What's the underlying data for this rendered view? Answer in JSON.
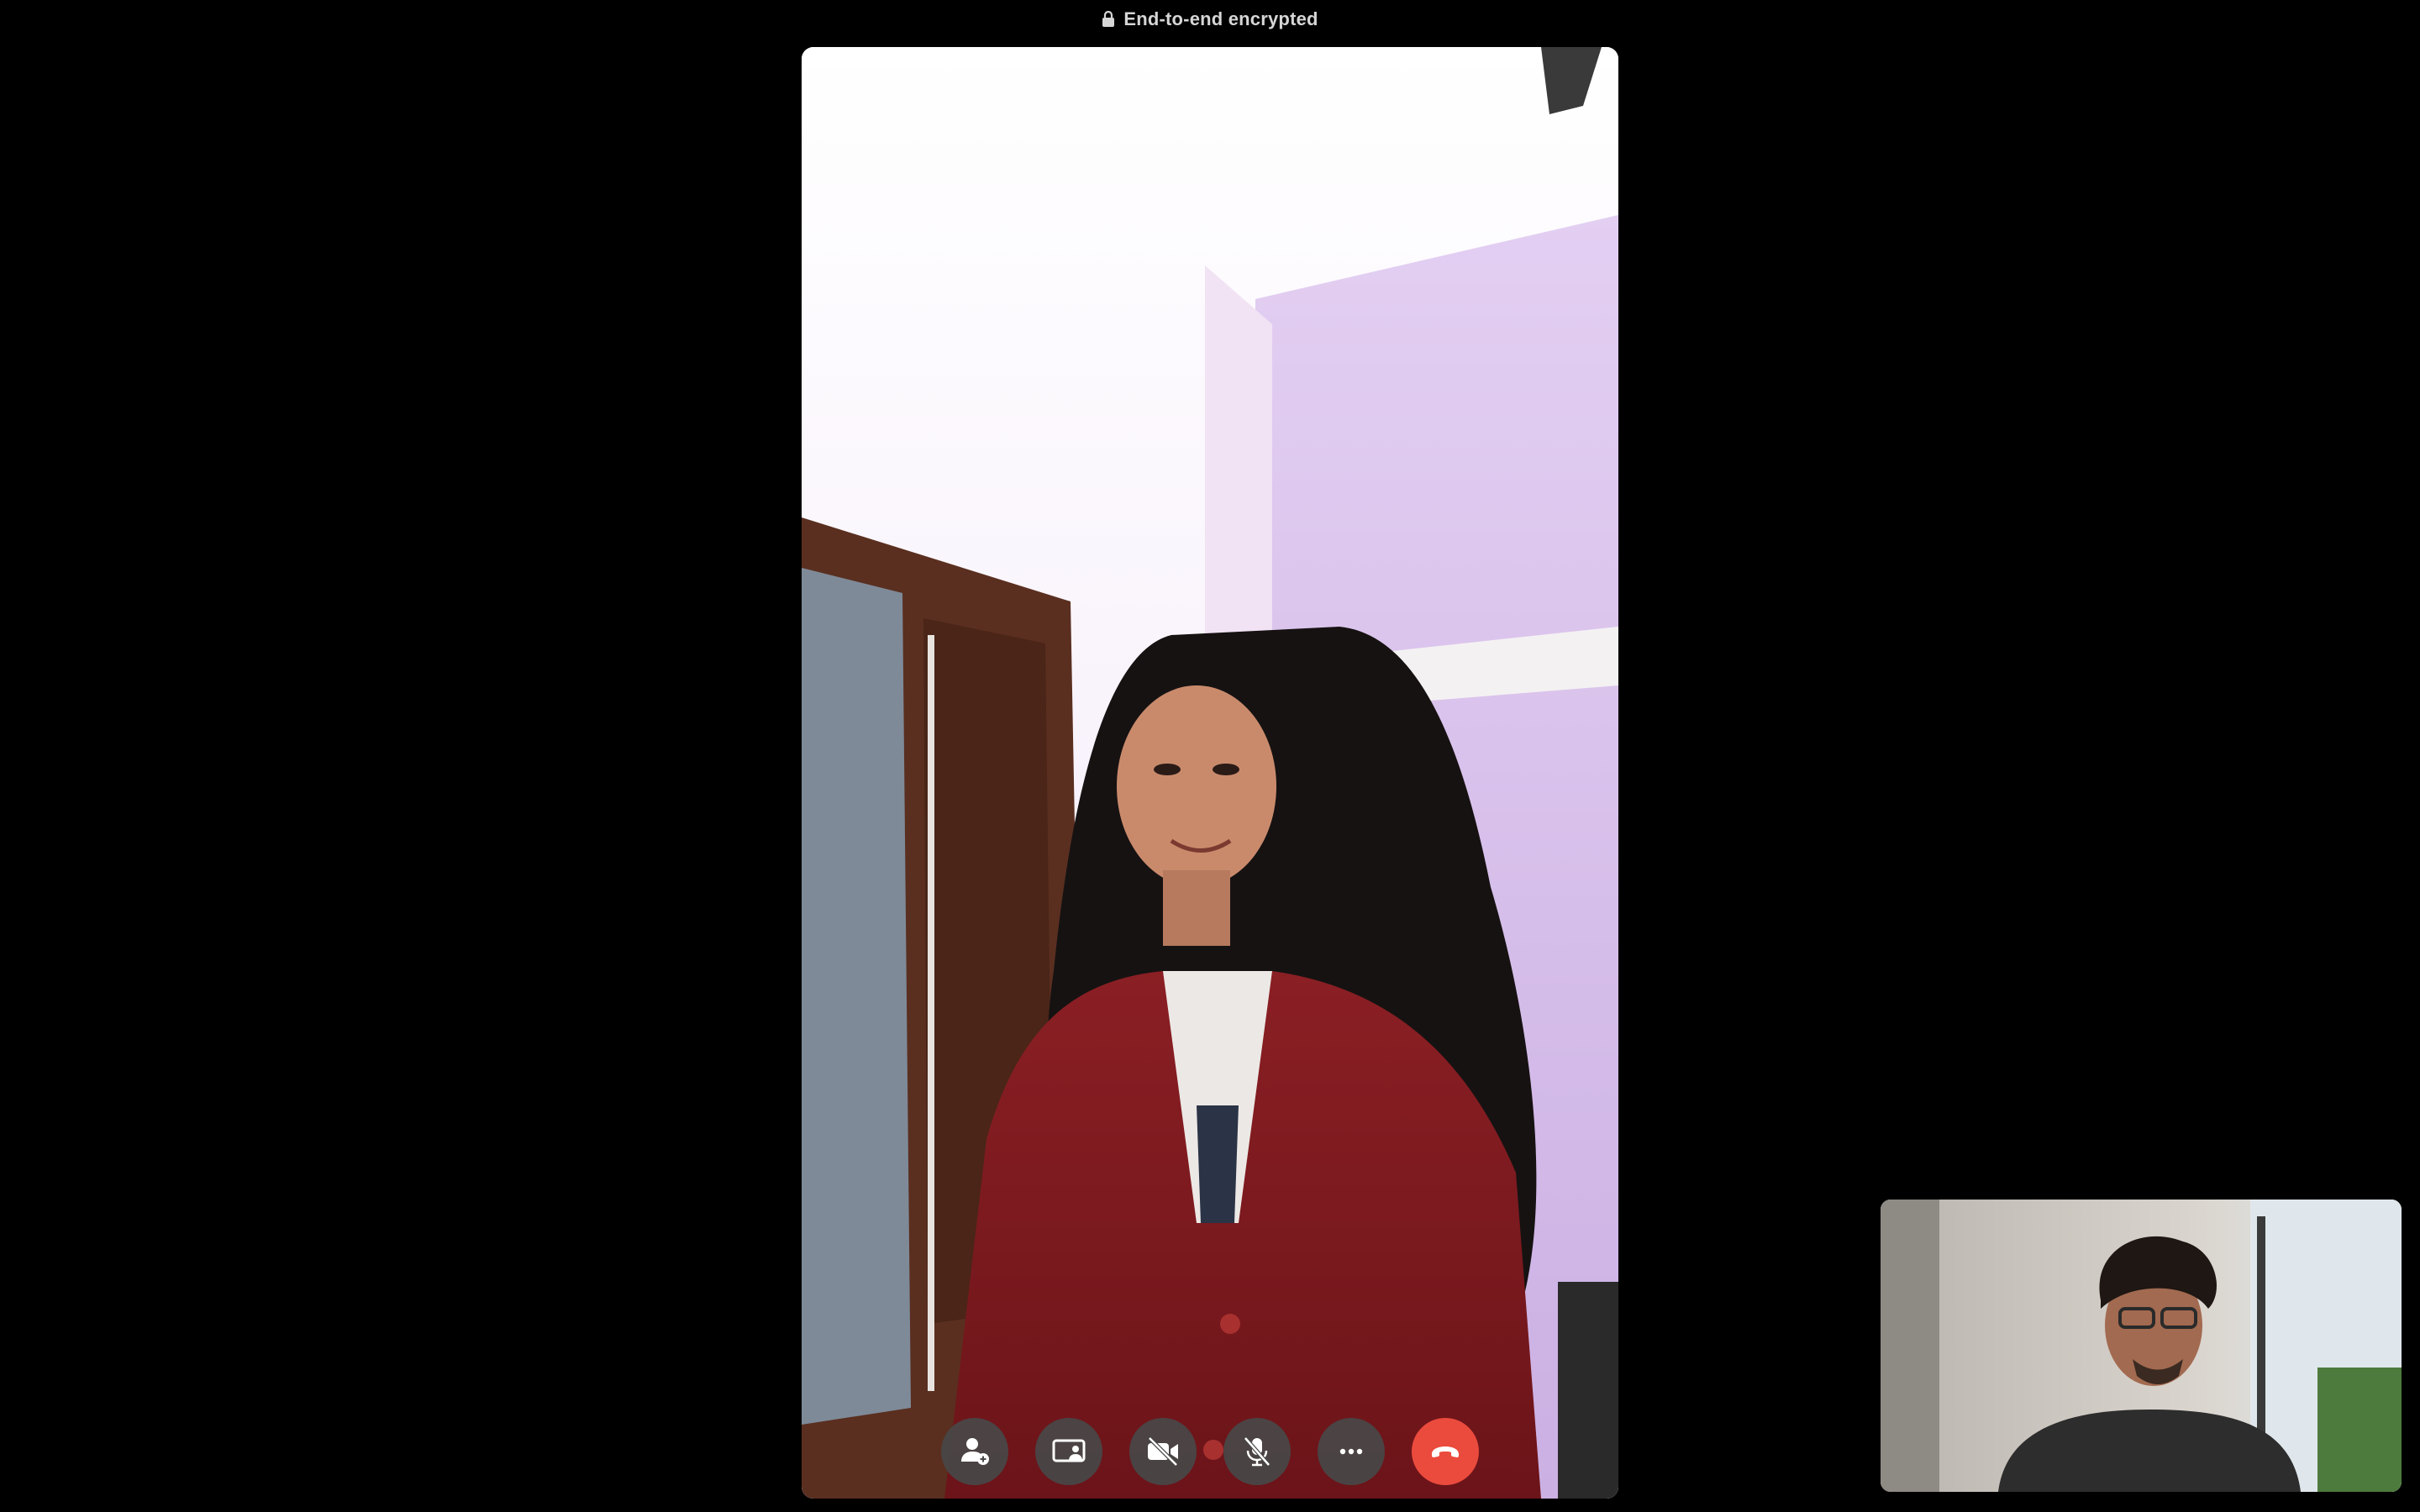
{
  "header": {
    "encryption_label": "End-to-end encrypted",
    "lock_icon": "lock-icon"
  },
  "call": {
    "remote_video": "remote-participant-video",
    "self_view": "self-view-video"
  },
  "controls": [
    {
      "name": "add-participant-button",
      "icon": "person-add-icon"
    },
    {
      "name": "share-screen-button",
      "icon": "screen-share-icon"
    },
    {
      "name": "camera-toggle-button",
      "icon": "video-off-icon"
    },
    {
      "name": "mute-button",
      "icon": "mic-off-icon"
    },
    {
      "name": "more-options-button",
      "icon": "more-horizontal-icon"
    },
    {
      "name": "end-call-button",
      "icon": "phone-hangup-icon"
    }
  ],
  "colors": {
    "background": "#000000",
    "end_call": "#eb4b3d",
    "control_bg": "#484848",
    "banner_text": "#d6d6d6"
  }
}
